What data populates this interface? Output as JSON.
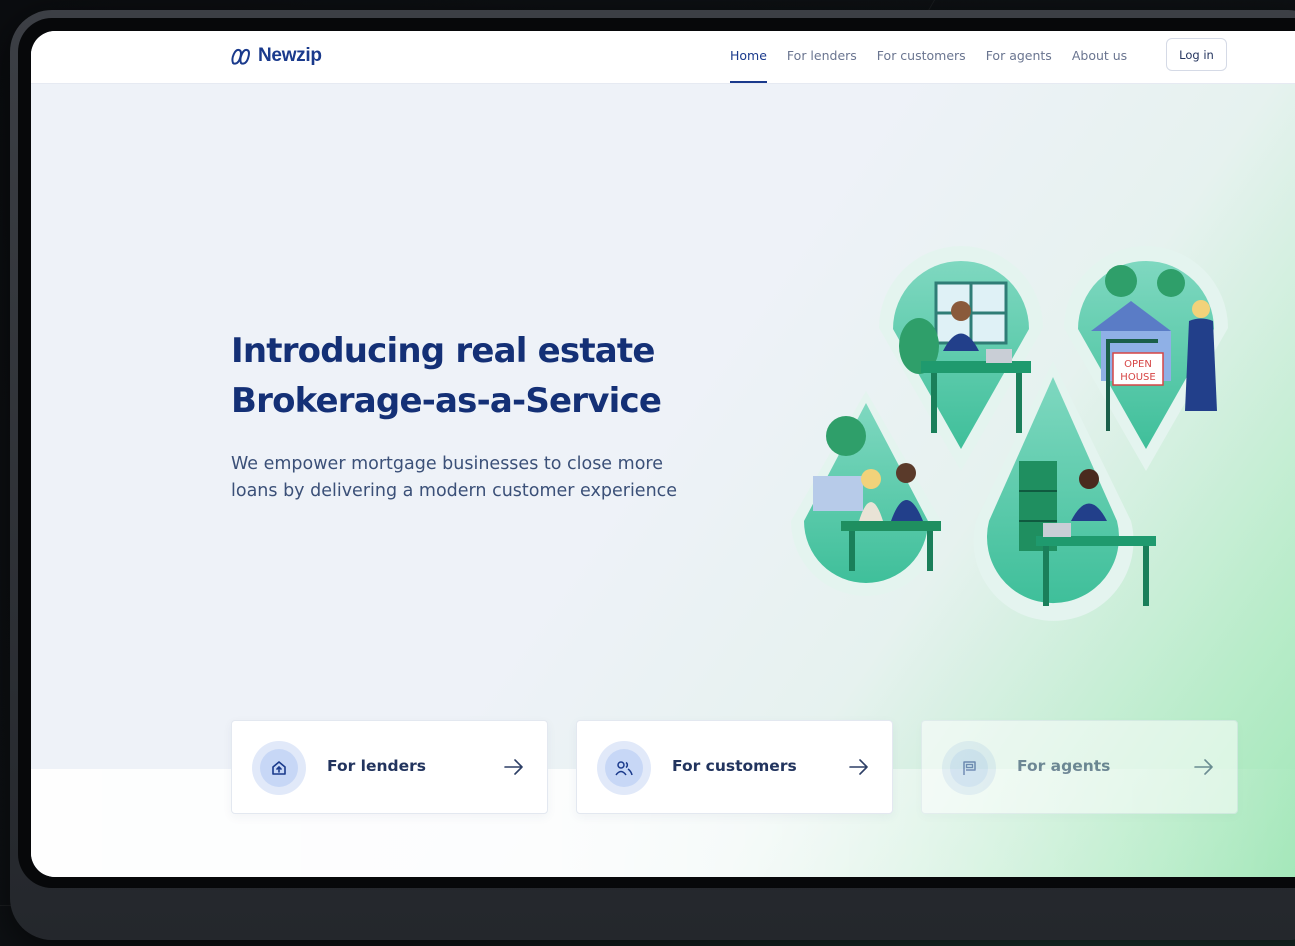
{
  "brand": {
    "name": "Newzip",
    "primary_color": "#1a3a8c",
    "accent_green": "#3fbf8f"
  },
  "nav": {
    "links": [
      {
        "label": "Home",
        "active": true
      },
      {
        "label": "For lenders",
        "active": false
      },
      {
        "label": "For customers",
        "active": false
      },
      {
        "label": "For agents",
        "active": false
      },
      {
        "label": "About us",
        "active": false
      }
    ],
    "login_label": "Log in"
  },
  "hero": {
    "title_line1": "Introducing real estate",
    "title_line2": "Brokerage-as-a-Service",
    "subtitle": "We empower mortgage businesses to close more loans by delivering a modern customer experience"
  },
  "illustration": {
    "sign_line1": "OPEN",
    "sign_line2": "HOUSE"
  },
  "cards": [
    {
      "label": "For lenders",
      "icon": "house-upload-icon"
    },
    {
      "label": "For customers",
      "icon": "users-icon"
    },
    {
      "label": "For agents",
      "icon": "sign-icon"
    }
  ]
}
